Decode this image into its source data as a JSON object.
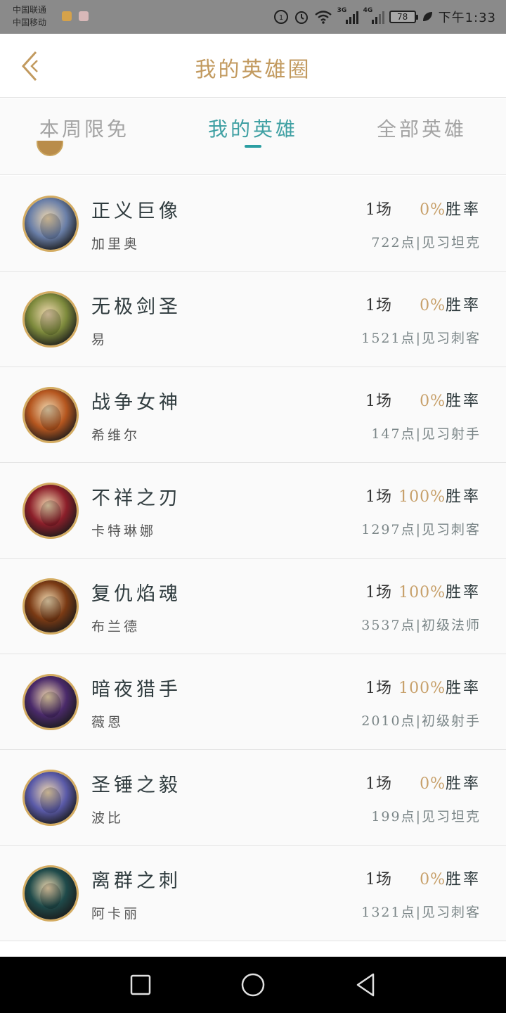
{
  "status_bar": {
    "carrier_1": "中国联通",
    "carrier_2": "中国移动",
    "battery": "78",
    "time": "下午1:33",
    "net_1": "3G",
    "net_2": "4G"
  },
  "header": {
    "title": "我的英雄圈",
    "back_icon": "back-arrow-icon"
  },
  "tabs": [
    {
      "label": "本周限免",
      "active": false
    },
    {
      "label": "我的英雄",
      "active": true
    },
    {
      "label": "全部英雄",
      "active": false
    }
  ],
  "heroes": [
    {
      "name": "正义巨像",
      "subname": "加里奥",
      "games": "1场",
      "win_pct": "0%",
      "win_label": "胜率",
      "points": "722点|见习坦克",
      "avatar_color": "#6a7fa8"
    },
    {
      "name": "无极剑圣",
      "subname": "易",
      "games": "1场",
      "win_pct": "0%",
      "win_label": "胜率",
      "points": "1521点|见习刺客",
      "avatar_color": "#7d8a3c"
    },
    {
      "name": "战争女神",
      "subname": "希维尔",
      "games": "1场",
      "win_pct": "0%",
      "win_label": "胜率",
      "points": "147点|见习射手",
      "avatar_color": "#b5561f"
    },
    {
      "name": "不祥之刃",
      "subname": "卡特琳娜",
      "games": "1场",
      "win_pct": "100%",
      "win_label": "胜率",
      "points": "1297点|见习刺客",
      "avatar_color": "#8c1f2a"
    },
    {
      "name": "复仇焰魂",
      "subname": "布兰德",
      "games": "1场",
      "win_pct": "100%",
      "win_label": "胜率",
      "points": "3537点|初级法师",
      "avatar_color": "#7a3a14"
    },
    {
      "name": "暗夜猎手",
      "subname": "薇恩",
      "games": "1场",
      "win_pct": "100%",
      "win_label": "胜率",
      "points": "2010点|初级射手",
      "avatar_color": "#4a2a6a"
    },
    {
      "name": "圣锤之毅",
      "subname": "波比",
      "games": "1场",
      "win_pct": "0%",
      "win_label": "胜率",
      "points": "199点|见习坦克",
      "avatar_color": "#5a5aa8"
    },
    {
      "name": "离群之刺",
      "subname": "阿卡丽",
      "games": "1场",
      "win_pct": "0%",
      "win_label": "胜率",
      "points": "1321点|见习刺客",
      "avatar_color": "#1f4a4a"
    }
  ],
  "navbar": {
    "recent_icon": "square-icon",
    "home_icon": "circle-icon",
    "back_icon": "triangle-back-icon"
  },
  "colors": {
    "accent_gold": "#c29a5f",
    "accent_teal": "#2b9ea2",
    "avatar_border": "#d4ac62"
  }
}
